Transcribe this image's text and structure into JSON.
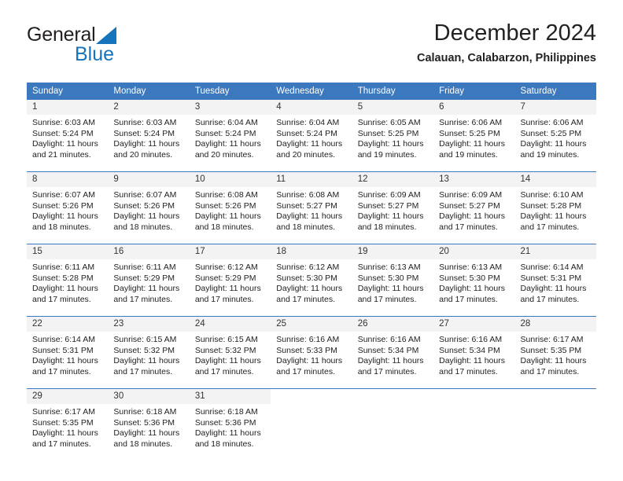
{
  "brand": {
    "name_top": "General",
    "name_bottom": "Blue",
    "triangle_color": "#1574bb",
    "text_color": "#231f20"
  },
  "header": {
    "title": "December 2024",
    "location": "Calauan, Calabarzon, Philippines"
  },
  "colors": {
    "header_blue": "#3c78bd",
    "daynum_band": "#f3f3f3",
    "text": "#222222",
    "brand_blue": "#1574bb"
  },
  "calendar": {
    "weekday_headers": [
      "Sunday",
      "Monday",
      "Tuesday",
      "Wednesday",
      "Thursday",
      "Friday",
      "Saturday"
    ],
    "weeks": [
      [
        {
          "day": "1",
          "sunrise": "Sunrise: 6:03 AM",
          "sunset": "Sunset: 5:24 PM",
          "daylight_line1": "Daylight: 11 hours",
          "daylight_line2": "and 21 minutes."
        },
        {
          "day": "2",
          "sunrise": "Sunrise: 6:03 AM",
          "sunset": "Sunset: 5:24 PM",
          "daylight_line1": "Daylight: 11 hours",
          "daylight_line2": "and 20 minutes."
        },
        {
          "day": "3",
          "sunrise": "Sunrise: 6:04 AM",
          "sunset": "Sunset: 5:24 PM",
          "daylight_line1": "Daylight: 11 hours",
          "daylight_line2": "and 20 minutes."
        },
        {
          "day": "4",
          "sunrise": "Sunrise: 6:04 AM",
          "sunset": "Sunset: 5:24 PM",
          "daylight_line1": "Daylight: 11 hours",
          "daylight_line2": "and 20 minutes."
        },
        {
          "day": "5",
          "sunrise": "Sunrise: 6:05 AM",
          "sunset": "Sunset: 5:25 PM",
          "daylight_line1": "Daylight: 11 hours",
          "daylight_line2": "and 19 minutes."
        },
        {
          "day": "6",
          "sunrise": "Sunrise: 6:06 AM",
          "sunset": "Sunset: 5:25 PM",
          "daylight_line1": "Daylight: 11 hours",
          "daylight_line2": "and 19 minutes."
        },
        {
          "day": "7",
          "sunrise": "Sunrise: 6:06 AM",
          "sunset": "Sunset: 5:25 PM",
          "daylight_line1": "Daylight: 11 hours",
          "daylight_line2": "and 19 minutes."
        }
      ],
      [
        {
          "day": "8",
          "sunrise": "Sunrise: 6:07 AM",
          "sunset": "Sunset: 5:26 PM",
          "daylight_line1": "Daylight: 11 hours",
          "daylight_line2": "and 18 minutes."
        },
        {
          "day": "9",
          "sunrise": "Sunrise: 6:07 AM",
          "sunset": "Sunset: 5:26 PM",
          "daylight_line1": "Daylight: 11 hours",
          "daylight_line2": "and 18 minutes."
        },
        {
          "day": "10",
          "sunrise": "Sunrise: 6:08 AM",
          "sunset": "Sunset: 5:26 PM",
          "daylight_line1": "Daylight: 11 hours",
          "daylight_line2": "and 18 minutes."
        },
        {
          "day": "11",
          "sunrise": "Sunrise: 6:08 AM",
          "sunset": "Sunset: 5:27 PM",
          "daylight_line1": "Daylight: 11 hours",
          "daylight_line2": "and 18 minutes."
        },
        {
          "day": "12",
          "sunrise": "Sunrise: 6:09 AM",
          "sunset": "Sunset: 5:27 PM",
          "daylight_line1": "Daylight: 11 hours",
          "daylight_line2": "and 18 minutes."
        },
        {
          "day": "13",
          "sunrise": "Sunrise: 6:09 AM",
          "sunset": "Sunset: 5:27 PM",
          "daylight_line1": "Daylight: 11 hours",
          "daylight_line2": "and 17 minutes."
        },
        {
          "day": "14",
          "sunrise": "Sunrise: 6:10 AM",
          "sunset": "Sunset: 5:28 PM",
          "daylight_line1": "Daylight: 11 hours",
          "daylight_line2": "and 17 minutes."
        }
      ],
      [
        {
          "day": "15",
          "sunrise": "Sunrise: 6:11 AM",
          "sunset": "Sunset: 5:28 PM",
          "daylight_line1": "Daylight: 11 hours",
          "daylight_line2": "and 17 minutes."
        },
        {
          "day": "16",
          "sunrise": "Sunrise: 6:11 AM",
          "sunset": "Sunset: 5:29 PM",
          "daylight_line1": "Daylight: 11 hours",
          "daylight_line2": "and 17 minutes."
        },
        {
          "day": "17",
          "sunrise": "Sunrise: 6:12 AM",
          "sunset": "Sunset: 5:29 PM",
          "daylight_line1": "Daylight: 11 hours",
          "daylight_line2": "and 17 minutes."
        },
        {
          "day": "18",
          "sunrise": "Sunrise: 6:12 AM",
          "sunset": "Sunset: 5:30 PM",
          "daylight_line1": "Daylight: 11 hours",
          "daylight_line2": "and 17 minutes."
        },
        {
          "day": "19",
          "sunrise": "Sunrise: 6:13 AM",
          "sunset": "Sunset: 5:30 PM",
          "daylight_line1": "Daylight: 11 hours",
          "daylight_line2": "and 17 minutes."
        },
        {
          "day": "20",
          "sunrise": "Sunrise: 6:13 AM",
          "sunset": "Sunset: 5:30 PM",
          "daylight_line1": "Daylight: 11 hours",
          "daylight_line2": "and 17 minutes."
        },
        {
          "day": "21",
          "sunrise": "Sunrise: 6:14 AM",
          "sunset": "Sunset: 5:31 PM",
          "daylight_line1": "Daylight: 11 hours",
          "daylight_line2": "and 17 minutes."
        }
      ],
      [
        {
          "day": "22",
          "sunrise": "Sunrise: 6:14 AM",
          "sunset": "Sunset: 5:31 PM",
          "daylight_line1": "Daylight: 11 hours",
          "daylight_line2": "and 17 minutes."
        },
        {
          "day": "23",
          "sunrise": "Sunrise: 6:15 AM",
          "sunset": "Sunset: 5:32 PM",
          "daylight_line1": "Daylight: 11 hours",
          "daylight_line2": "and 17 minutes."
        },
        {
          "day": "24",
          "sunrise": "Sunrise: 6:15 AM",
          "sunset": "Sunset: 5:32 PM",
          "daylight_line1": "Daylight: 11 hours",
          "daylight_line2": "and 17 minutes."
        },
        {
          "day": "25",
          "sunrise": "Sunrise: 6:16 AM",
          "sunset": "Sunset: 5:33 PM",
          "daylight_line1": "Daylight: 11 hours",
          "daylight_line2": "and 17 minutes."
        },
        {
          "day": "26",
          "sunrise": "Sunrise: 6:16 AM",
          "sunset": "Sunset: 5:34 PM",
          "daylight_line1": "Daylight: 11 hours",
          "daylight_line2": "and 17 minutes."
        },
        {
          "day": "27",
          "sunrise": "Sunrise: 6:16 AM",
          "sunset": "Sunset: 5:34 PM",
          "daylight_line1": "Daylight: 11 hours",
          "daylight_line2": "and 17 minutes."
        },
        {
          "day": "28",
          "sunrise": "Sunrise: 6:17 AM",
          "sunset": "Sunset: 5:35 PM",
          "daylight_line1": "Daylight: 11 hours",
          "daylight_line2": "and 17 minutes."
        }
      ],
      [
        {
          "day": "29",
          "sunrise": "Sunrise: 6:17 AM",
          "sunset": "Sunset: 5:35 PM",
          "daylight_line1": "Daylight: 11 hours",
          "daylight_line2": "and 17 minutes."
        },
        {
          "day": "30",
          "sunrise": "Sunrise: 6:18 AM",
          "sunset": "Sunset: 5:36 PM",
          "daylight_line1": "Daylight: 11 hours",
          "daylight_line2": "and 18 minutes."
        },
        {
          "day": "31",
          "sunrise": "Sunrise: 6:18 AM",
          "sunset": "Sunset: 5:36 PM",
          "daylight_line1": "Daylight: 11 hours",
          "daylight_line2": "and 18 minutes."
        },
        {
          "day": "",
          "sunrise": "",
          "sunset": "",
          "daylight_line1": "",
          "daylight_line2": ""
        },
        {
          "day": "",
          "sunrise": "",
          "sunset": "",
          "daylight_line1": "",
          "daylight_line2": ""
        },
        {
          "day": "",
          "sunrise": "",
          "sunset": "",
          "daylight_line1": "",
          "daylight_line2": ""
        },
        {
          "day": "",
          "sunrise": "",
          "sunset": "",
          "daylight_line1": "",
          "daylight_line2": ""
        }
      ]
    ]
  }
}
